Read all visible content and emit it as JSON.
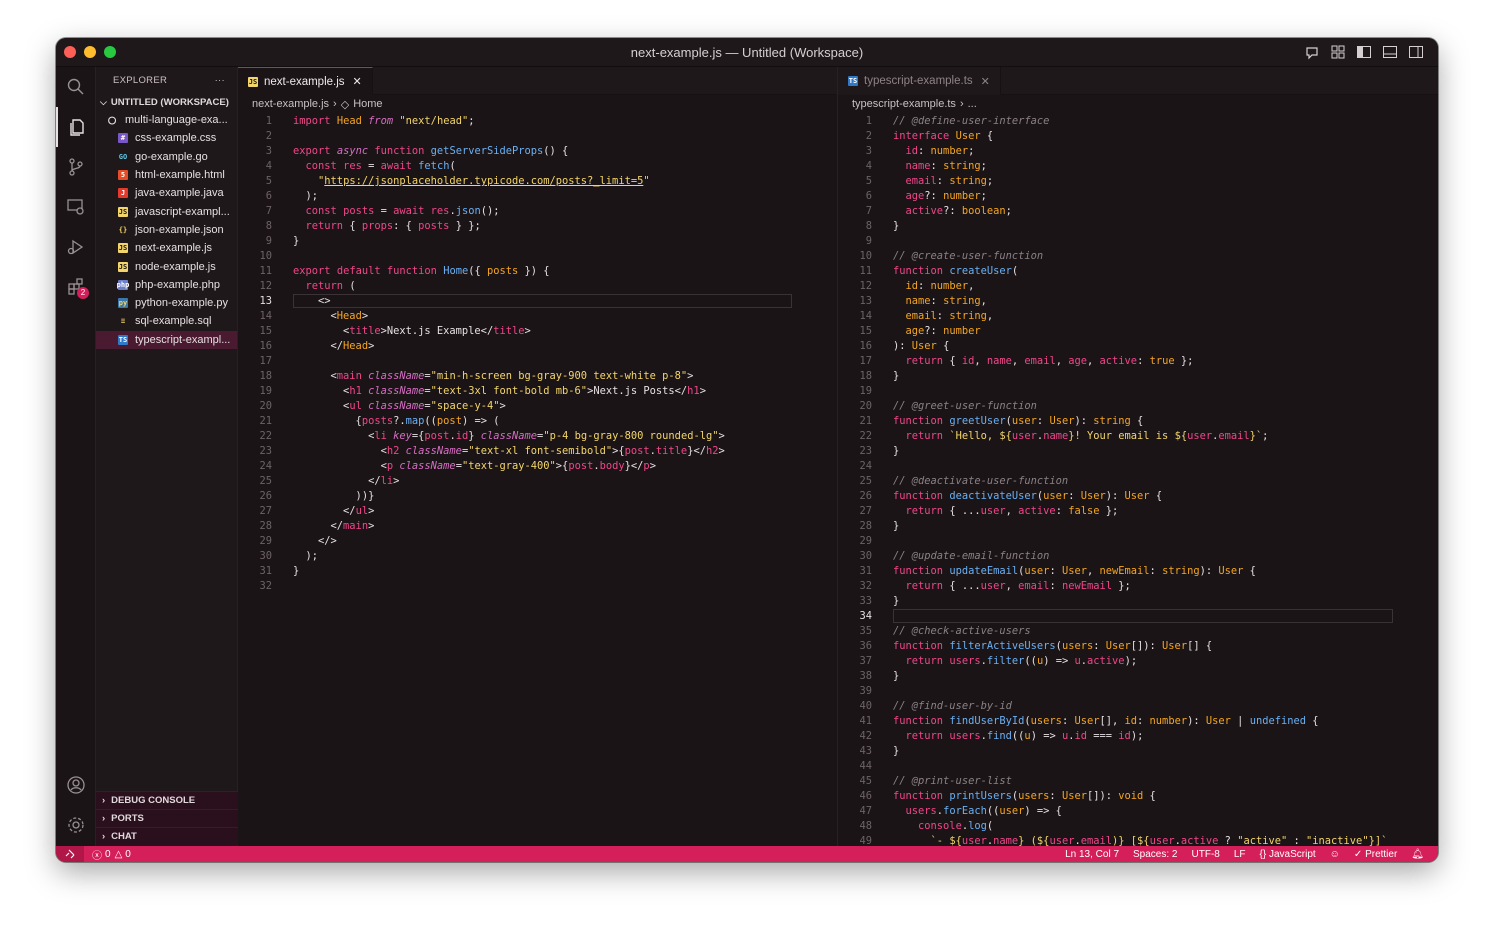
{
  "window": {
    "title": "next-example.js — Untitled (Workspace)"
  },
  "sidebar": {
    "header": "EXPLORER",
    "more": "···",
    "workspace": "UNTITLED (WORKSPACE)",
    "items": [
      {
        "label": "multi-language-exa...",
        "icon": "circle-icon"
      },
      {
        "label": "css-example.css",
        "icon": "css-file-icon"
      },
      {
        "label": "go-example.go",
        "icon": "go-file-icon"
      },
      {
        "label": "html-example.html",
        "icon": "html-file-icon"
      },
      {
        "label": "java-example.java",
        "icon": "java-file-icon"
      },
      {
        "label": "javascript-exampl...",
        "icon": "js-file-icon"
      },
      {
        "label": "json-example.json",
        "icon": "json-file-icon"
      },
      {
        "label": "next-example.js",
        "icon": "js-file-icon"
      },
      {
        "label": "node-example.js",
        "icon": "js-file-icon"
      },
      {
        "label": "php-example.php",
        "icon": "php-file-icon"
      },
      {
        "label": "python-example.py",
        "icon": "python-file-icon"
      },
      {
        "label": "sql-example.sql",
        "icon": "sql-file-icon"
      },
      {
        "label": "typescript-exampl...",
        "icon": "ts-file-icon"
      }
    ],
    "panels": [
      "DEBUG CONSOLE",
      "PORTS",
      "CHAT"
    ]
  },
  "activity": {
    "extensions_badge": "2"
  },
  "left_editor": {
    "tab": "next-example.js",
    "breadcrumb": [
      "next-example.js",
      "Home"
    ],
    "current_line": 13
  },
  "right_editor": {
    "tab": "typescript-example.ts",
    "breadcrumb": [
      "typescript-example.ts",
      "..."
    ],
    "current_line": 34
  },
  "status": {
    "errors": "0",
    "warnings": "0",
    "position": "Ln 13, Col 7",
    "spaces": "Spaces: 2",
    "encoding": "UTF-8",
    "eol": "LF",
    "language": "JavaScript",
    "formatter": "Prettier"
  },
  "colors": {
    "accent": "#d51f5a",
    "background": "#1a1416"
  }
}
